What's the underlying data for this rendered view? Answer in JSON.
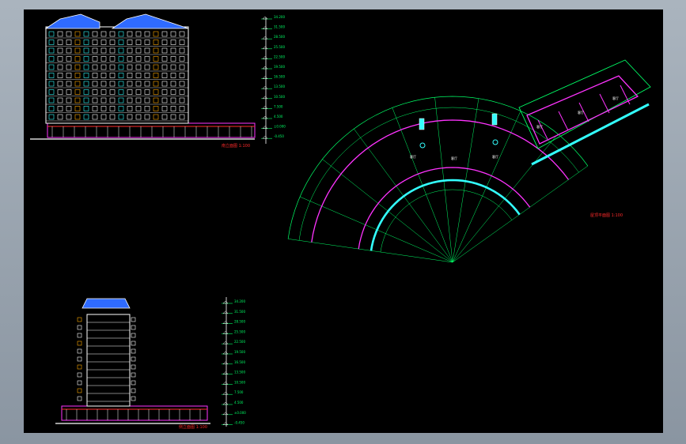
{
  "viewer": {
    "accent_bg": "#000000",
    "frame_color": "#9aa5b0",
    "line_colors": {
      "white": "#ffffff",
      "green": "#00ff66",
      "magenta": "#ff33ff",
      "cyan": "#33ffff",
      "red": "#ff2a2a",
      "blue": "#2f6bff",
      "orange": "#ffaa00",
      "yellow": "#ffff33"
    }
  },
  "drawing": {
    "front_elevation": {
      "title": "南立面图 1:100",
      "levels": [
        "34.200",
        "31.500",
        "28.500",
        "25.500",
        "22.500",
        "19.500",
        "16.500",
        "13.500",
        "10.500",
        "7.500",
        "4.500",
        "±0.000",
        "-0.450"
      ]
    },
    "plan": {
      "title": "屋顶平面图 1:100",
      "room_label": "客厅"
    },
    "side_elevation": {
      "title": "侧立面图 1:100",
      "levels": [
        "34.200",
        "31.500",
        "28.500",
        "25.500",
        "22.500",
        "19.500",
        "16.500",
        "13.500",
        "10.500",
        "7.500",
        "4.500",
        "±0.000",
        "-0.450"
      ]
    }
  }
}
